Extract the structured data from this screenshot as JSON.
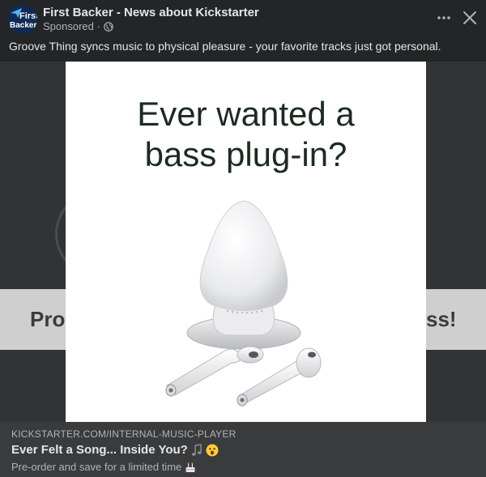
{
  "header": {
    "avatar_line1": "First",
    "avatar_line2": "Backer",
    "page_name": "First Backer - News about Kickstarter",
    "sponsored_label": "Sponsored · "
  },
  "post": {
    "text": "Groove Thing syncs music to physical pleasure - your favorite tracks just got personal."
  },
  "media": {
    "background_left_text": "Pro",
    "background_right_text": "ss!",
    "headline_line1": "Ever wanted a",
    "headline_line2": "bass plug-in?"
  },
  "link": {
    "domain": "KICKSTARTER.COM/INTERNAL-MUSIC-PLAYER",
    "title": "Ever Felt a Song... Inside You?",
    "description": "Pre-order and save for a limited time"
  },
  "icons": {
    "globe": "globe-icon",
    "more": "more-options-icon",
    "close": "close-icon",
    "music_note": "music-note-emoji",
    "surprised": "surprised-face-emoji",
    "cake": "cake-emoji"
  },
  "colors": {
    "background": "#242526",
    "link_area": "#3a3b3c",
    "text_primary": "#e4e6eb",
    "text_secondary": "#b0b3b8",
    "headline": "#1b2b20"
  }
}
